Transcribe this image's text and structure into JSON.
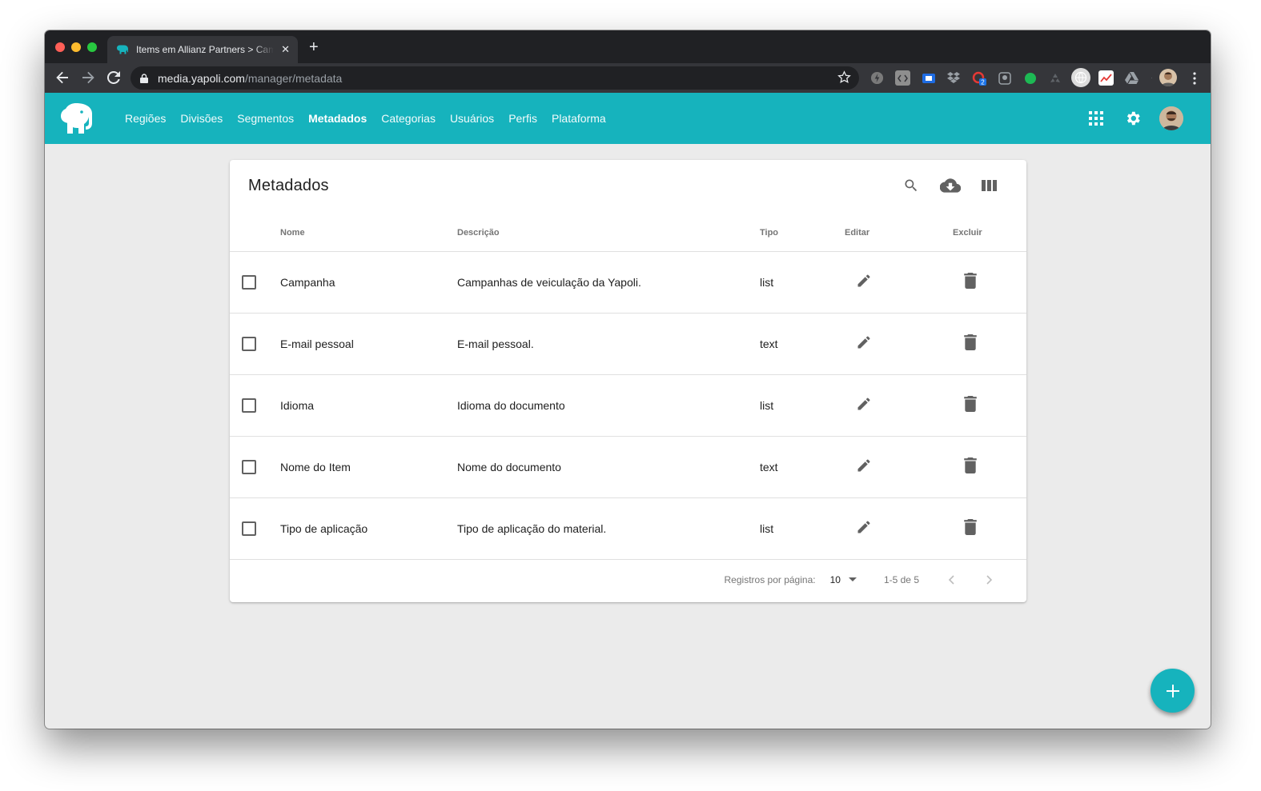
{
  "browser": {
    "tab_title": "Items em Allianz Partners > Campanha",
    "url_host": "media.yapoli.com",
    "url_path": "/manager/metadata",
    "extension_badge": "2"
  },
  "nav": {
    "items": [
      {
        "label": "Regiões"
      },
      {
        "label": "Divisões"
      },
      {
        "label": "Segmentos"
      },
      {
        "label": "Metadados",
        "active": true
      },
      {
        "label": "Categorias"
      },
      {
        "label": "Usuários"
      },
      {
        "label": "Perfis"
      },
      {
        "label": "Plataforma"
      }
    ]
  },
  "card": {
    "title": "Metadados",
    "columns": {
      "name": "Nome",
      "description": "Descrição",
      "type": "Tipo",
      "edit": "Editar",
      "delete": "Excluir"
    },
    "rows": [
      {
        "name": "Campanha",
        "description": "Campanhas de veiculação da Yapoli.",
        "type": "list"
      },
      {
        "name": "E-mail pessoal",
        "description": "E-mail pessoal.",
        "type": "text"
      },
      {
        "name": "Idioma",
        "description": "Idioma do documento",
        "type": "list"
      },
      {
        "name": "Nome do Item",
        "description": "Nome do documento",
        "type": "text"
      },
      {
        "name": "Tipo de aplicação",
        "description": "Tipo de aplicação do material.",
        "type": "list"
      }
    ],
    "footer": {
      "rows_per_page_label": "Registros por página:",
      "rows_per_page_value": "10",
      "range": "1-5 de 5"
    }
  },
  "colors": {
    "brand": "#16b3bd",
    "icon_gray": "#616161"
  },
  "icons": {
    "search": "search-icon",
    "download": "cloud-download-icon",
    "columns": "view-columns-icon",
    "edit": "pencil-icon",
    "delete": "trash-icon",
    "add": "plus-icon"
  }
}
